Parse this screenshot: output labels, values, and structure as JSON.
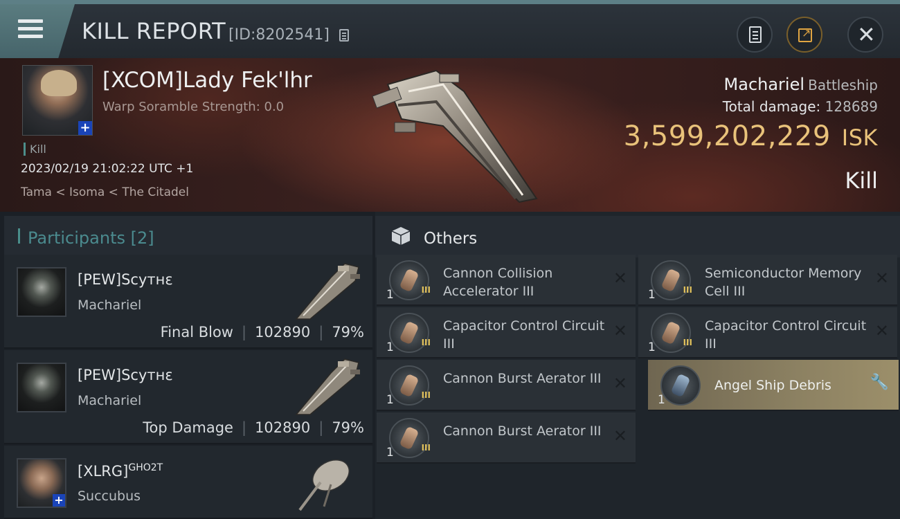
{
  "header": {
    "title": "KILL REPORT",
    "report_id": "[ID:8202541]"
  },
  "victim": {
    "name": "[XCOM]Lady Fek'lhr",
    "warp": "Warp Soramble Strength: 0.0",
    "tag": "Kill",
    "datetime": "2023/02/19 21:02:22 UTC +1",
    "location": "Tama < Isoma < The Citadel",
    "ship_name": "Machariel",
    "ship_class": "Battleship",
    "total_damage_label": "Total damage:",
    "total_damage": "128689",
    "isk_value": "3,599,202,229",
    "isk_unit": "ISK",
    "result": "Kill"
  },
  "participants": {
    "label": "Participants",
    "count": "[2]",
    "rows": [
      {
        "name": "[PEW]Scyтнε",
        "ship": "Machariel",
        "role": "Final Blow",
        "damage": "102890",
        "percent": "79%"
      },
      {
        "name": "[PEW]Scyтнε",
        "ship": "Machariel",
        "role": "Top Damage",
        "damage": "102890",
        "percent": "79%"
      },
      {
        "name": "[XLRG]",
        "name_sup": "GHO2T",
        "ship": "Succubus"
      }
    ]
  },
  "others": {
    "label": "Others",
    "items": [
      {
        "qty": "1",
        "name": "Cannon Collision Accelerator III",
        "tier": "III"
      },
      {
        "qty": "1",
        "name": "Semiconductor Memory Cell III",
        "tier": "III"
      },
      {
        "qty": "1",
        "name": "Capacitor Control Circuit III",
        "tier": "III"
      },
      {
        "qty": "1",
        "name": "Capacitor Control Circuit III",
        "tier": "III"
      },
      {
        "qty": "1",
        "name": "Cannon Burst Aerator III",
        "tier": "III"
      },
      {
        "qty": "1",
        "name": "Angel Ship Debris"
      },
      {
        "qty": "1",
        "name": "Cannon Burst Aerator III",
        "tier": "III"
      }
    ]
  },
  "colors": {
    "isk_gold": "#e9c27a",
    "accent_teal": "#4a8e8b",
    "highlight_item": "#8c8162"
  }
}
